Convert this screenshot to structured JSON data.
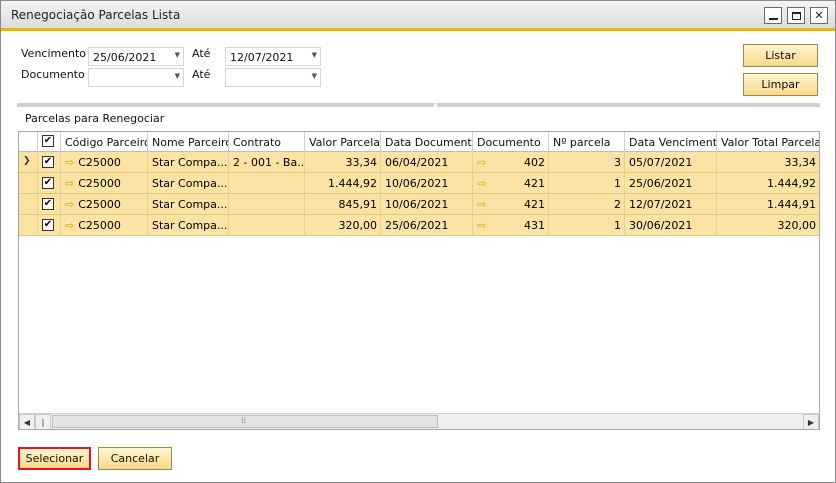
{
  "window": {
    "title": "Renegociação Parcelas Lista"
  },
  "filters": {
    "vencimento_label": "Vencimento",
    "vencimento_from": "25/06/2021",
    "ate_label": "Até",
    "vencimento_to": "12/07/2021",
    "documento_label": "Documento",
    "documento_from": "",
    "documento_ate_label": "Até",
    "documento_to": ""
  },
  "buttons": {
    "listar": "Listar",
    "limpar": "Limpar",
    "selecionar": "Selecionar",
    "cancelar": "Cancelar"
  },
  "section": {
    "title": "Parcelas para Renegociar"
  },
  "table": {
    "columns": [
      "Código Parceiro",
      "Nome Parceiro",
      "Contrato",
      "Valor Parcela",
      "Data Documento",
      "Documento",
      "Nº parcela",
      "Data Vencimento",
      "Valor Total Parcela"
    ],
    "rows": [
      [
        "C25000",
        "Star Compa...",
        "2 - 001 - Ba...",
        "33,34",
        "06/04/2021",
        "402",
        "3",
        "05/07/2021",
        "33,34"
      ],
      [
        "C25000",
        "Star Compa...",
        "",
        "1.444,92",
        "10/06/2021",
        "421",
        "1",
        "25/06/2021",
        "1.444,92"
      ],
      [
        "C25000",
        "Star Compa...",
        "",
        "845,91",
        "10/06/2021",
        "421",
        "2",
        "12/07/2021",
        "1.444,91"
      ],
      [
        "C25000",
        "Star Compa...",
        "",
        "320,00",
        "25/06/2021",
        "431",
        "1",
        "30/06/2021",
        "320,00"
      ]
    ],
    "checked": [
      true,
      true,
      true,
      true
    ],
    "header_checked": true
  },
  "colors": {
    "accent": "#f0b400",
    "row_highlight": "#fbe3a4",
    "focus_border": "#e8141e"
  },
  "icons": {
    "link_arrow": "link-arrow-icon"
  }
}
